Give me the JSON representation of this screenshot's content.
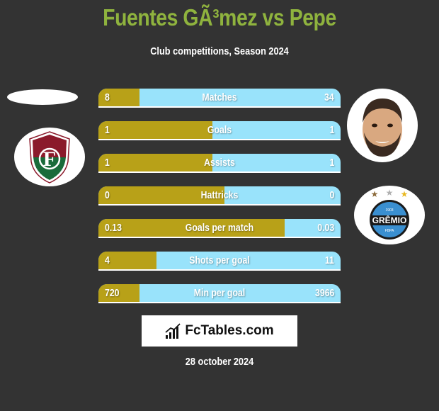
{
  "header": {
    "title": "Fuentes GÃ³mez vs Pepe",
    "subtitle": "Club competitions, Season 2024"
  },
  "colors": {
    "background": "#333333",
    "title": "#8fb33e",
    "left_bar": "#b8a118",
    "right_bar": "#99e3fb"
  },
  "players": {
    "left": {
      "name": "Fuentes GÃ³mez",
      "club_logo": "fluminense-crest-icon",
      "photo": "placeholder-oval"
    },
    "right": {
      "name": "Pepe",
      "photo": "player-photo",
      "club_logo": "gremio-crest-icon"
    }
  },
  "stats": [
    {
      "label": "Matches",
      "left": "8",
      "right": "34",
      "left_fill_pct": 17
    },
    {
      "label": "Goals",
      "left": "1",
      "right": "1",
      "left_fill_pct": 47
    },
    {
      "label": "Assists",
      "left": "1",
      "right": "1",
      "left_fill_pct": 47
    },
    {
      "label": "Hattricks",
      "left": "0",
      "right": "0",
      "left_fill_pct": 52
    },
    {
      "label": "Goals per match",
      "left": "0.13",
      "right": "0.03",
      "left_fill_pct": 77
    },
    {
      "label": "Shots per goal",
      "left": "4",
      "right": "11",
      "left_fill_pct": 24
    },
    {
      "label": "Min per goal",
      "left": "720",
      "right": "3966",
      "left_fill_pct": 17
    }
  ],
  "brand": {
    "name": "FcTables.com",
    "icon": "bar-chart-icon"
  },
  "footer": {
    "date": "28 october 2024"
  }
}
